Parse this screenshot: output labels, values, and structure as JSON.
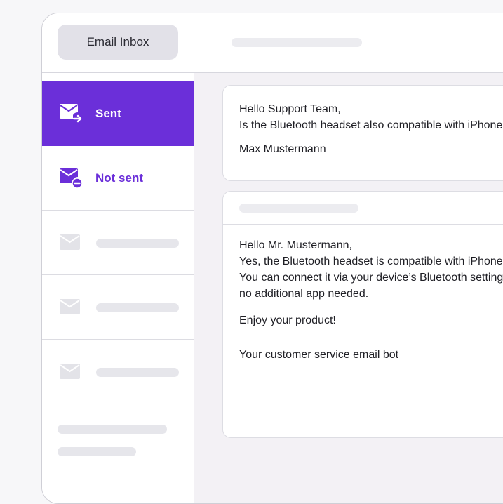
{
  "header": {
    "title": "Email Inbox"
  },
  "sidebar": {
    "items": [
      {
        "label": "Sent",
        "icon": "mail-sent-icon"
      },
      {
        "label": "Not sent",
        "icon": "mail-not-sent-icon"
      },
      {
        "label": "",
        "icon": "mail-icon"
      },
      {
        "label": "",
        "icon": "mail-icon"
      },
      {
        "label": "",
        "icon": "mail-icon"
      }
    ]
  },
  "messages": {
    "incoming": {
      "greeting": "Hello Support Team,",
      "body": "Is the Bluetooth headset also compatible with iPhone",
      "signature": "Max Mustermann"
    },
    "reply": {
      "greeting": "Hello Mr. Mustermann,",
      "line1": "Yes, the Bluetooth headset is compatible with iPhone",
      "line2": "You can connect it via your device’s Bluetooth setting",
      "line3": "no additional app needed.",
      "closing": "Enjoy your product!",
      "signature": "Your customer service email bot"
    }
  },
  "colors": {
    "accent": "#6b2fd9",
    "inactive_icon": "#e3e3e8"
  }
}
